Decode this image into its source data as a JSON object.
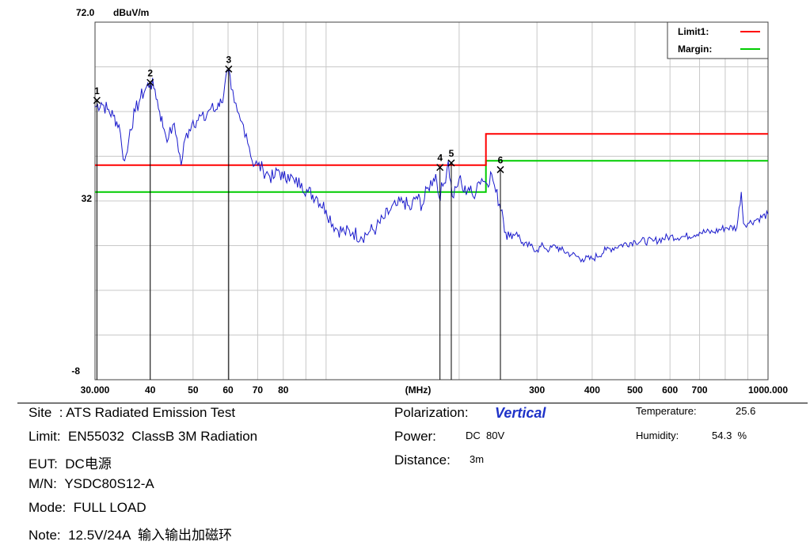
{
  "chart_data": {
    "type": "line",
    "y_unit": "dBuV/m",
    "y_top_label": "72.0",
    "y_mid_label": "32",
    "y_bottom_label": "-8",
    "ylim": [
      -8,
      72
    ],
    "x_scale": "log",
    "xlim": [
      30,
      1000
    ],
    "x_tick_labels": [
      {
        "v": 30,
        "t": "30.000"
      },
      {
        "v": 40,
        "t": "40"
      },
      {
        "v": 50,
        "t": "50"
      },
      {
        "v": 60,
        "t": "60"
      },
      {
        "v": 70,
        "t": "70"
      },
      {
        "v": 80,
        "t": "80"
      },
      {
        "v": 300,
        "t": "300"
      },
      {
        "v": 400,
        "t": "400"
      },
      {
        "v": 500,
        "t": "500"
      },
      {
        "v": 600,
        "t": "600"
      },
      {
        "v": 700,
        "t": "700"
      },
      {
        "v": 1000,
        "t": "1000.000"
      }
    ],
    "x_unit_label": "(MHz)",
    "grid": true,
    "legend": [
      {
        "name": "Limit1:",
        "color": "#ff0000"
      },
      {
        "name": "Margin:",
        "color": "#00cc00"
      }
    ],
    "legend_position": "top-right",
    "limit_line": {
      "name": "Limit1",
      "color": "#ff0000",
      "points": [
        [
          30,
          40
        ],
        [
          230,
          40
        ],
        [
          230,
          47
        ],
        [
          1000,
          47
        ]
      ]
    },
    "margin_line": {
      "name": "Margin",
      "color": "#00cc00",
      "points": [
        [
          30,
          34
        ],
        [
          230,
          34
        ],
        [
          230,
          41
        ],
        [
          1000,
          41
        ]
      ]
    },
    "trace_color": "#1a1acc",
    "trace": [
      [
        30,
        53
      ],
      [
        31,
        54
      ],
      [
        32,
        52.5
      ],
      [
        33,
        51
      ],
      [
        34,
        49
      ],
      [
        34.5,
        44
      ],
      [
        35,
        41
      ],
      [
        35.5,
        43
      ],
      [
        36,
        48
      ],
      [
        37,
        52
      ],
      [
        38,
        55
      ],
      [
        39,
        57
      ],
      [
        40,
        58.5
      ],
      [
        41,
        57
      ],
      [
        42,
        52
      ],
      [
        43,
        48
      ],
      [
        44,
        46
      ],
      [
        45,
        49
      ],
      [
        46,
        46
      ],
      [
        47,
        40
      ],
      [
        48,
        46
      ],
      [
        49,
        48
      ],
      [
        50,
        50
      ],
      [
        51,
        50
      ],
      [
        52,
        51
      ],
      [
        53,
        50
      ],
      [
        54,
        52
      ],
      [
        55,
        53
      ],
      [
        56,
        52
      ],
      [
        57,
        54
      ],
      [
        58,
        54
      ],
      [
        59,
        58
      ],
      [
        60,
        61
      ],
      [
        61,
        57
      ],
      [
        62,
        54
      ],
      [
        63,
        52
      ],
      [
        64,
        50
      ],
      [
        65,
        49
      ],
      [
        66,
        47
      ],
      [
        67,
        44
      ],
      [
        68,
        41
      ],
      [
        70,
        40
      ],
      [
        72,
        39
      ],
      [
        74,
        38
      ],
      [
        76,
        37
      ],
      [
        78,
        39
      ],
      [
        80,
        37
      ],
      [
        82,
        38
      ],
      [
        85,
        36
      ],
      [
        88,
        36
      ],
      [
        91,
        34
      ],
      [
        95,
        33
      ],
      [
        100,
        30
      ],
      [
        105,
        26
      ],
      [
        110,
        25
      ],
      [
        115,
        25
      ],
      [
        120,
        24
      ],
      [
        125,
        25
      ],
      [
        130,
        26
      ],
      [
        135,
        28
      ],
      [
        140,
        30
      ],
      [
        145,
        31
      ],
      [
        150,
        32
      ],
      [
        155,
        30
      ],
      [
        160,
        33
      ],
      [
        165,
        31
      ],
      [
        170,
        35
      ],
      [
        175,
        37
      ],
      [
        177,
        38
      ],
      [
        180,
        33
      ],
      [
        185,
        36
      ],
      [
        189,
        41
      ],
      [
        193,
        33
      ],
      [
        197,
        35
      ],
      [
        200,
        37
      ],
      [
        205,
        34
      ],
      [
        210,
        35
      ],
      [
        215,
        33
      ],
      [
        220,
        36
      ],
      [
        225,
        37
      ],
      [
        230,
        36
      ],
      [
        237,
        38
      ],
      [
        242,
        34
      ],
      [
        250,
        30
      ],
      [
        255,
        25
      ],
      [
        260,
        24
      ],
      [
        270,
        25
      ],
      [
        280,
        22
      ],
      [
        290,
        22
      ],
      [
        300,
        21
      ],
      [
        310,
        22
      ],
      [
        320,
        21
      ],
      [
        330,
        22
      ],
      [
        340,
        21
      ],
      [
        360,
        20
      ],
      [
        380,
        19
      ],
      [
        400,
        19
      ],
      [
        430,
        21
      ],
      [
        460,
        22
      ],
      [
        500,
        23
      ],
      [
        550,
        23
      ],
      [
        600,
        24
      ],
      [
        650,
        24
      ],
      [
        700,
        25
      ],
      [
        750,
        25
      ],
      [
        800,
        26
      ],
      [
        850,
        26
      ],
      [
        870,
        34
      ],
      [
        880,
        27
      ],
      [
        900,
        27
      ],
      [
        950,
        28
      ],
      [
        1000,
        29
      ]
    ],
    "markers": [
      {
        "label": "1",
        "f": 30.3,
        "v": 54.5
      },
      {
        "label": "2",
        "f": 40,
        "v": 58.5
      },
      {
        "label": "3",
        "f": 60.2,
        "v": 61.5
      },
      {
        "label": "4",
        "f": 181,
        "v": 39.5
      },
      {
        "label": "5",
        "f": 192,
        "v": 40.5
      },
      {
        "label": "6",
        "f": 248,
        "v": 39
      }
    ]
  },
  "info": {
    "site": "Site  : ATS Radiated Emission Test",
    "limit": "Limit:  EN55032  ClassB 3M Radiation",
    "eut": "EUT:  DC电源",
    "mn": "M/N:  YSDC80S12-A",
    "mode": "Mode:  FULL LOAD",
    "note": "Note:  12.5V/24A  输入输出加磁环",
    "polarization_label": "Polarization:",
    "polarization_value": "Vertical",
    "power_label": "Power:",
    "power_value": "DC  80V",
    "distance_label": "Distance:",
    "distance_value": "3m",
    "temperature_label": "Temperature:",
    "temperature_value": "25.6",
    "humidity_label": "Humidity:",
    "humidity_value": "54.3  %"
  }
}
